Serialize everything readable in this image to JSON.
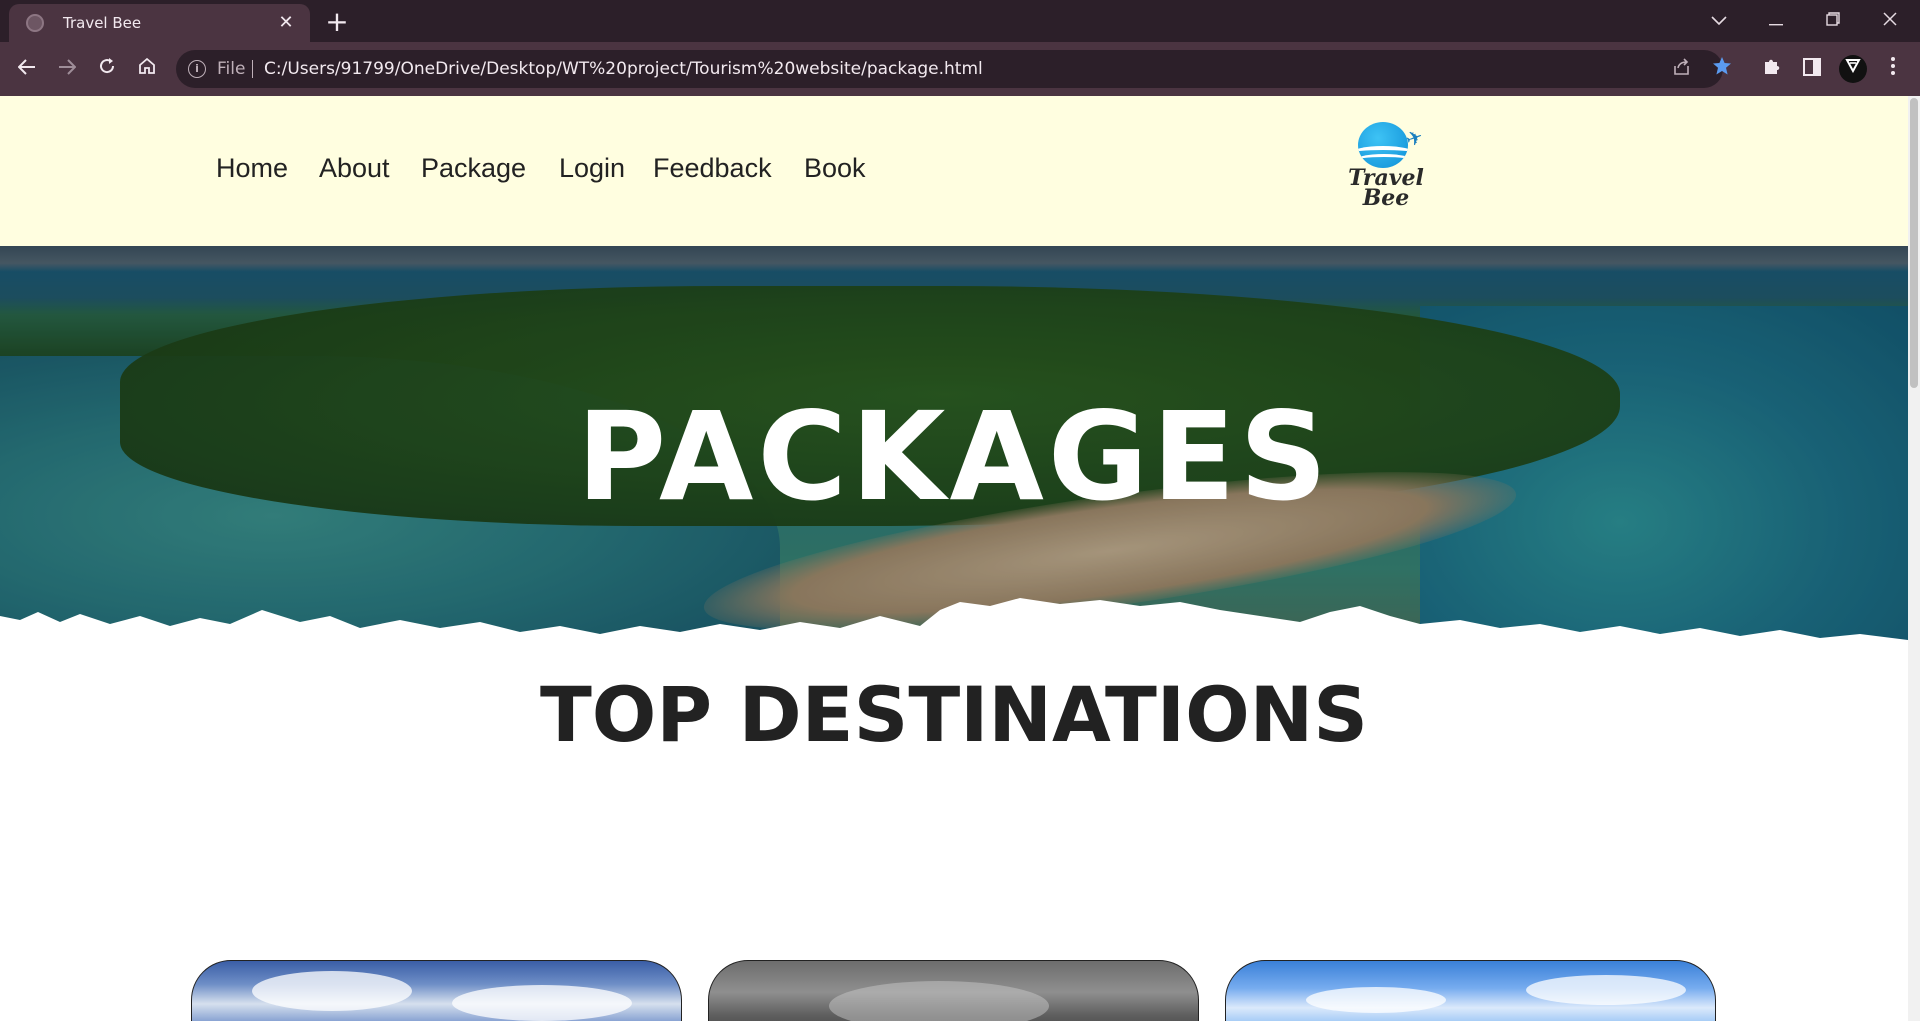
{
  "browser": {
    "tab_title": "Travel Bee",
    "tab_close": "✕",
    "new_tab": "+",
    "omnibox": {
      "info_icon": "i",
      "scheme_label": "File",
      "url": "C:/Users/91799/OneDrive/Desktop/WT%20project/Tourism%20website/package.html"
    },
    "icons": {
      "back": "back-arrow-icon",
      "forward": "forward-arrow-icon",
      "reload": "reload-icon",
      "home": "home-icon",
      "share": "share-icon",
      "bookmark": "star-icon",
      "extensions": "puzzle-icon",
      "side_panel": "side-panel-icon",
      "profile": "vpn-extension-icon",
      "menu": "kebab-menu-icon"
    },
    "colors": {
      "frame": "#2c1f29",
      "toolbar": "#4b3441",
      "accent_star": "#5b9bf0"
    }
  },
  "site": {
    "nav": [
      "Home",
      "About",
      "Package",
      "Login",
      "Feedback",
      "Book"
    ],
    "logo": {
      "line1": "Travel",
      "line2": "Bee"
    },
    "hero_title": "PACKAGES",
    "section_title": "TOP DESTINATIONS",
    "colors": {
      "header_bg": "#fffee0",
      "text": "#222222"
    }
  }
}
